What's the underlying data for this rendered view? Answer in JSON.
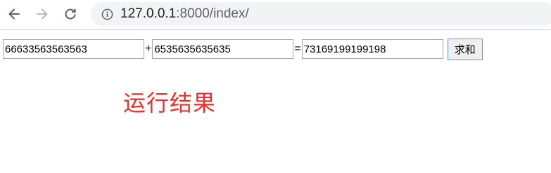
{
  "browser": {
    "back_icon": "arrow-left-icon",
    "forward_icon": "arrow-right-icon",
    "reload_icon": "reload-icon",
    "info_icon": "info-circle-icon",
    "url_host": "127.0.0.1",
    "url_rest": ":8000/index/"
  },
  "form": {
    "operand_a": "66633563563563",
    "plus_sign": "+",
    "operand_b": "6535635635635",
    "equals_sign": "=",
    "result": "73169199199198",
    "submit_label": "求和"
  },
  "result_label": "运行结果",
  "colors": {
    "result_label": "#e8312f",
    "button_border": "#6b8fd8"
  }
}
